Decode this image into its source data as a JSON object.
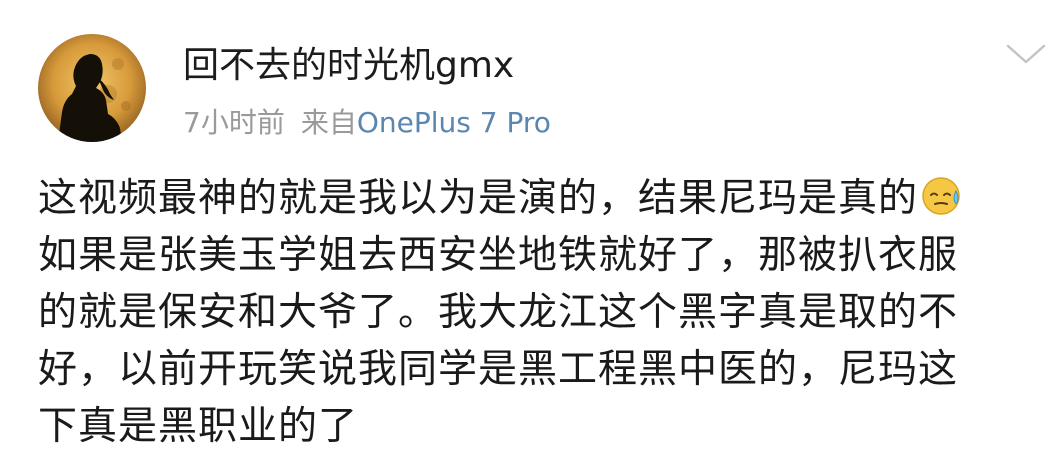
{
  "post": {
    "username": "回不去的时光机gmx",
    "time": "7小时前",
    "source_prefix": "来自",
    "device": "OnePlus 7 Pro",
    "content_lines": [
      "这视频最神的就是我以为是演的，结果尼玛是真的",
      "如果是张美玉学姐去西安坐地铁就好了，那被扒衣服",
      "的就是保安和大爷了。我大龙江这个黑字真是取的不",
      "好，以前开玩笑说我同学是黑工程黑中医的，尼玛这",
      "下真是黑职业的了"
    ],
    "inline_emoji": "sweat-emoji"
  },
  "icons": {
    "menu": "chevron-down-icon"
  },
  "colors": {
    "username": "#1c1c1c",
    "meta": "#9a9a9a",
    "device_link": "#5a86b0",
    "text": "#1a1a1a"
  }
}
